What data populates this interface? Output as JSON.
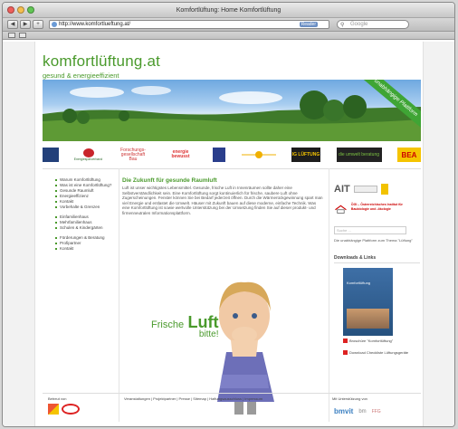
{
  "browser": {
    "title": "Komfortlüftung: Home Komfortlüftung",
    "url": "http://www.komfortlueftung.at/",
    "reload_badge": "Reader",
    "search_placeholder": "Google"
  },
  "site": {
    "logo_main": "komfortlüftung.at",
    "logo_sub": "gesund & energieeffizient",
    "ribbon": "Die unabhängige Plattform"
  },
  "partners": [
    "",
    "Energiesparverband",
    "Forschungs-gesellschaft Bau",
    "energie bewusst",
    "",
    "",
    "IG LÜFTUNG",
    "die umwelt beratung",
    "BEA"
  ],
  "nav": {
    "group1": [
      "Warum Komfortlüftung",
      "Was ist eine Komfortlüftung?",
      "Gesunde Raumluft",
      "Energieeffizienz",
      "Kontakt",
      "Vorbehalte & Grenzen"
    ],
    "group2": [
      "Einfamilienhaus",
      "Mehrfamilienhaus",
      "Schulen & Kindergärten"
    ],
    "group3": [
      "Förderungen & Beratung",
      "Profipartner",
      "Kontakt"
    ]
  },
  "main": {
    "heading": "Die Zukunft für gesunde Raumluft",
    "body": "Luft ist unser wichtigstes Lebensmittel. Gesunde, frische Luft in Innenräumen sollte daher eine Selbstverständlichkeit sein. Eine Komfortlüftung sorgt kontinuierlich für frische, saubere Luft ohne Zugerscheinungen. Fenster können Sie bei Bedarf jederzeit öffnen. Durch die Wärmerückgewinnung spart man viel Energie und entlastet die Umwelt. Häuser mit Zukunft bauen auf diese moderne, einfache Technik. Was eine Komfortlüftung ist sowie wertvolle Unterstützung bei der Umsetzung finden Sie auf dieser produkt- und firmenneutralen Informationsplattform.",
    "frische_1": "Frische",
    "frische_2": "Luft",
    "frische_3": "bitte!"
  },
  "right": {
    "ait_logo": "AIT",
    "oegi_title": "ÖGI – Österreichisches Institut für Baubiologie und -ökologie",
    "input_placeholder": "Suche ...",
    "note": "Die unabhängige Plattform zum Thema \"Lüftung\"",
    "downloads_heading": "Downloads & Links",
    "brochure_title": "Komfortlüftung",
    "dl1": "Broschüre \"Komfortlüftung\"",
    "dl2": "Download Checkliste Lüftungsgeräte"
  },
  "footer": {
    "left": "Betreut von",
    "links": "Veranstaltungen | Projektpartner | Presse | Sitemap | Haftungsausschluss | Impressum",
    "right": "Mit Unterstützung von",
    "bmo": "bmvit",
    "bmo2": "bm",
    "ffg": "FFG"
  },
  "colors": {
    "brand_green": "#4a9a2c"
  }
}
